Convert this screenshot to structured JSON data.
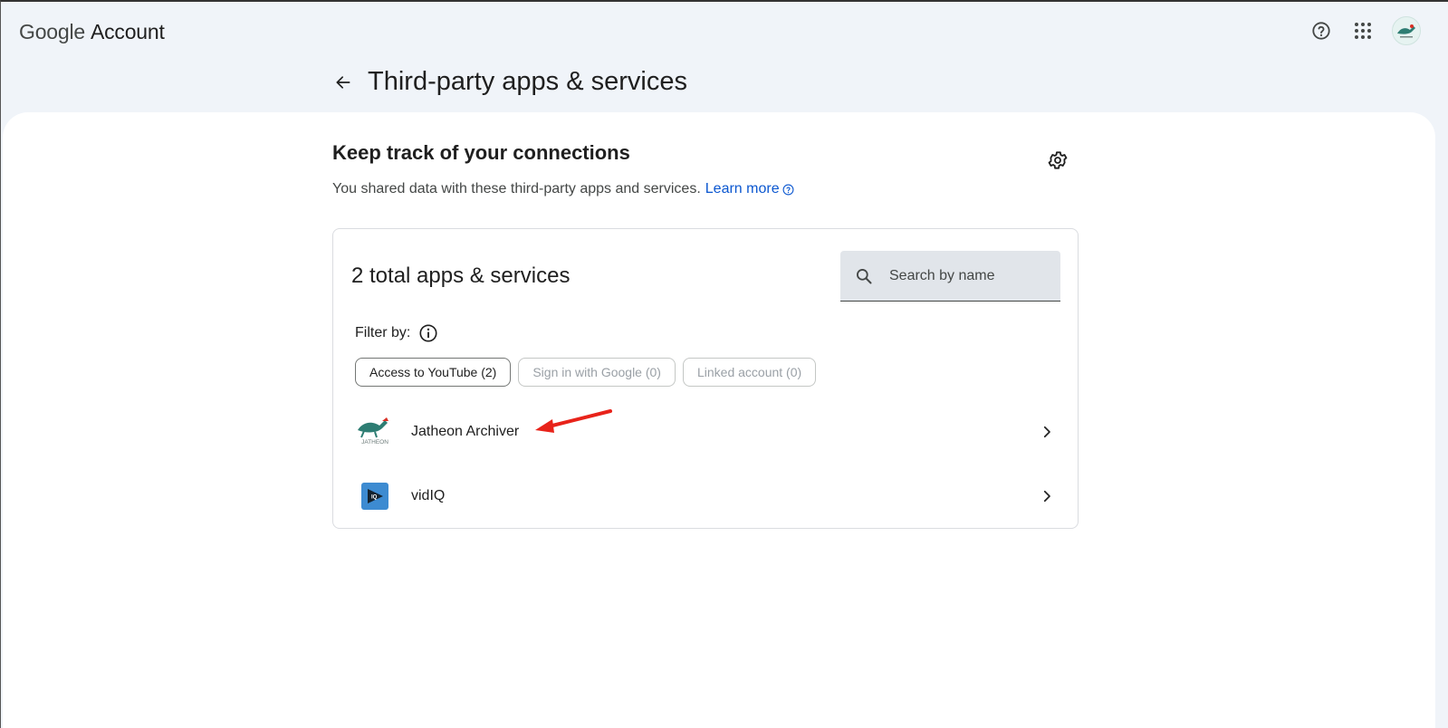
{
  "header": {
    "brand_google": "Google",
    "brand_account": "Account",
    "help_icon": "help-circle-icon",
    "apps_icon": "apps-grid-icon",
    "avatar_icon": "account-avatar"
  },
  "page": {
    "title": "Third-party apps & services",
    "back_icon": "arrow-back-icon"
  },
  "section": {
    "title": "Keep track of your connections",
    "description": "You shared data with these third-party apps and services.",
    "learn_more": "Learn more",
    "settings_icon": "gear-icon"
  },
  "card": {
    "total_label": "2 total apps & services",
    "search_placeholder": "Search by name",
    "filter_label": "Filter by:",
    "filters": [
      {
        "label": "Access to YouTube (2)",
        "active": true
      },
      {
        "label": "Sign in with Google (0)",
        "active": false
      },
      {
        "label": "Linked account (0)",
        "active": false
      }
    ],
    "apps": [
      {
        "name": "Jatheon Archiver",
        "logo": "jatheon-logo",
        "logo_text": "JATHEON"
      },
      {
        "name": "vidIQ",
        "logo": "vidiq-logo",
        "logo_text": "IQ"
      }
    ]
  },
  "colors": {
    "page_bg": "#f0f4f9",
    "link": "#0b57d0",
    "annotation_arrow": "#e8231a",
    "vidiq_blue": "#3d8bd1"
  }
}
